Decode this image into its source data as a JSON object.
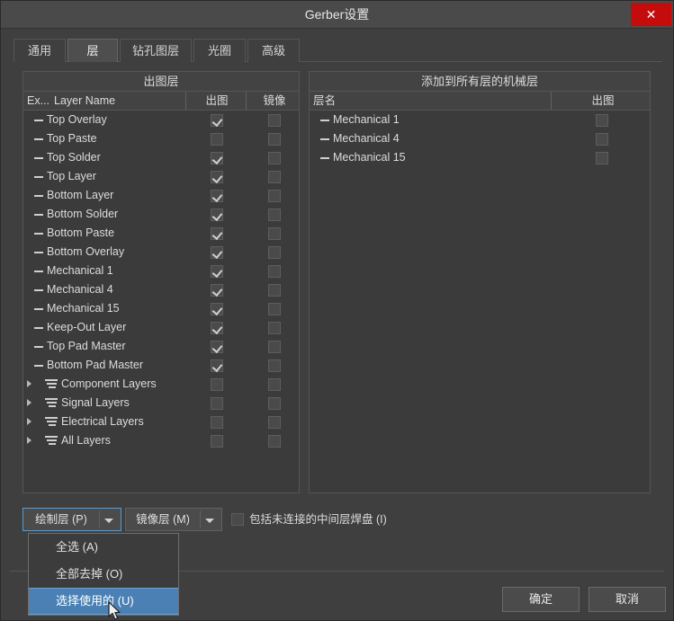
{
  "window": {
    "title": "Gerber设置",
    "close_label": "✕",
    "accent": "#c40c0c",
    "highlight": "#4a80b4"
  },
  "tabs": [
    {
      "label": "通用",
      "active": false
    },
    {
      "label": "层",
      "active": true
    },
    {
      "label": "钻孔图层",
      "active": false
    },
    {
      "label": "光圈",
      "active": false
    },
    {
      "label": "高级",
      "active": false
    }
  ],
  "left_panel": {
    "title": "出图层",
    "columns": {
      "extended": "Ex...",
      "name": "Layer Name",
      "plot": "出图",
      "mirror": "镜像"
    },
    "rows": [
      {
        "label": "Top Overlay",
        "type": "layer",
        "plot": true,
        "mirror": false
      },
      {
        "label": "Top Paste",
        "type": "layer",
        "plot": false,
        "mirror": false
      },
      {
        "label": "Top Solder",
        "type": "layer",
        "plot": true,
        "mirror": false
      },
      {
        "label": "Top Layer",
        "type": "layer",
        "plot": true,
        "mirror": false
      },
      {
        "label": "Bottom Layer",
        "type": "layer",
        "plot": true,
        "mirror": false
      },
      {
        "label": "Bottom Solder",
        "type": "layer",
        "plot": true,
        "mirror": false
      },
      {
        "label": "Bottom Paste",
        "type": "layer",
        "plot": true,
        "mirror": false
      },
      {
        "label": "Bottom Overlay",
        "type": "layer",
        "plot": true,
        "mirror": false
      },
      {
        "label": "Mechanical 1",
        "type": "layer",
        "plot": true,
        "mirror": false
      },
      {
        "label": "Mechanical 4",
        "type": "layer",
        "plot": true,
        "mirror": false
      },
      {
        "label": "Mechanical 15",
        "type": "layer",
        "plot": true,
        "mirror": false
      },
      {
        "label": "Keep-Out Layer",
        "type": "layer",
        "plot": true,
        "mirror": false
      },
      {
        "label": "Top Pad Master",
        "type": "layer",
        "plot": true,
        "mirror": false
      },
      {
        "label": "Bottom Pad Master",
        "type": "layer",
        "plot": true,
        "mirror": false
      },
      {
        "label": "Component Layers",
        "type": "group",
        "plot": false,
        "mirror": false
      },
      {
        "label": "Signal Layers",
        "type": "group",
        "plot": false,
        "mirror": false
      },
      {
        "label": "Electrical Layers",
        "type": "group",
        "plot": false,
        "mirror": false
      },
      {
        "label": "All Layers",
        "type": "group",
        "plot": false,
        "mirror": false
      }
    ]
  },
  "right_panel": {
    "title": "添加到所有层的机械层",
    "columns": {
      "name": "层名",
      "plot": "出图"
    },
    "rows": [
      {
        "label": "Mechanical 1",
        "type": "layer",
        "plot": false
      },
      {
        "label": "Mechanical 4",
        "type": "layer",
        "plot": false
      },
      {
        "label": "Mechanical 15",
        "type": "layer",
        "plot": false
      }
    ]
  },
  "controls": {
    "plot_layers_button": "绘制层 (P)",
    "mirror_layers_button": "镜像层 (M)",
    "include_unconnected_label": "包括未连接的中间层焊盘 (I)",
    "include_unconnected_checked": false
  },
  "menu": {
    "items": [
      {
        "label": "全选 (A)",
        "highlight": false
      },
      {
        "label": "全部去掉 (O)",
        "highlight": false
      },
      {
        "label": "选择使用的 (U)",
        "highlight": true
      }
    ]
  },
  "footer": {
    "ok_label": "确定",
    "cancel_label": "取消"
  }
}
